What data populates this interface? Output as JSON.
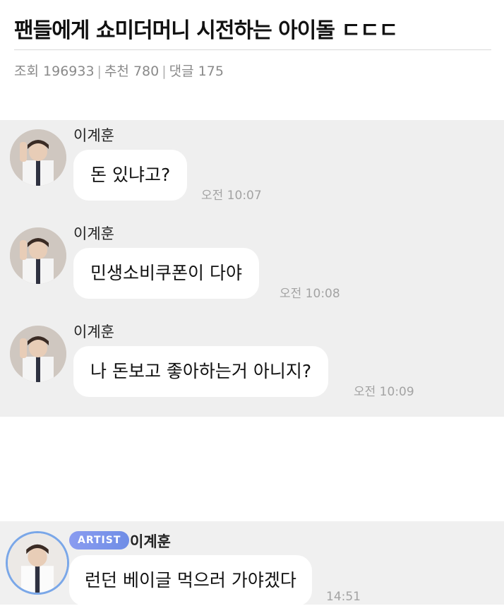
{
  "post": {
    "title": "팬들에게 쇼미더머니 시전하는 아이돌 ㄷㄷㄷ",
    "views_label": "조회",
    "views": "196933",
    "recommend_label": "추천",
    "recommend": "780",
    "comments_label": "댓글",
    "comments": "175"
  },
  "messages": [
    {
      "sender": "이계훈",
      "text": "돈 있냐고?",
      "time": "오전 10:07"
    },
    {
      "sender": "이계훈",
      "text": "민생소비쿠폰이 다야",
      "time": "오전 10:08"
    },
    {
      "sender": "이계훈",
      "text": "나 돈보고 좋아하는거 아니지?",
      "time": "오전 10:09"
    }
  ],
  "artist_message": {
    "badge": "ARTIST",
    "sender": "이계훈",
    "text": "런던 베이글 먹으러 가야겠다",
    "time": "14:51"
  },
  "colors": {
    "chat_bg": "#efefef",
    "bubble_bg": "#ffffff",
    "time_text": "#a3a3a3",
    "artist_ring": "#7aa7e8",
    "artist_badge": "#7e95ec"
  }
}
